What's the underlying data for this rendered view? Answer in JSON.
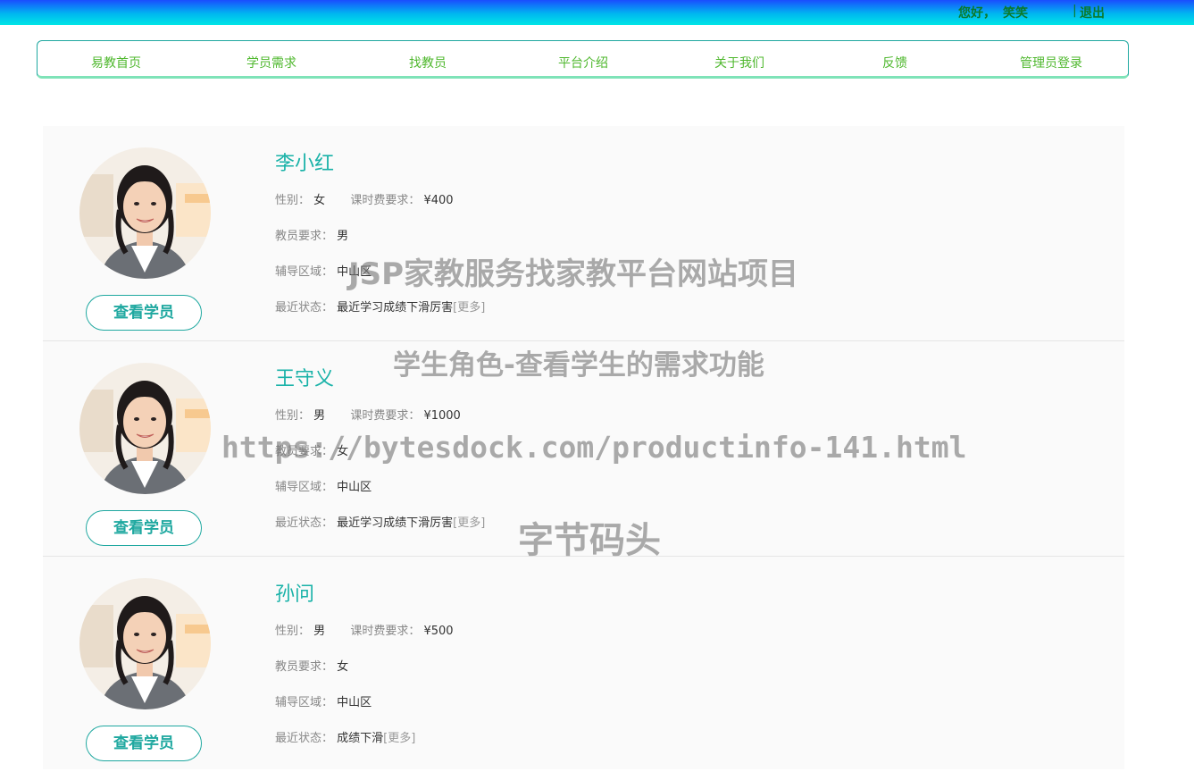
{
  "header": {
    "greeting": "您好，",
    "username": "笑笑",
    "separator": "|",
    "logout_label": "退出"
  },
  "nav": {
    "items": [
      {
        "label": "易教首页"
      },
      {
        "label": "学员需求"
      },
      {
        "label": "找教员"
      },
      {
        "label": "平台介绍"
      },
      {
        "label": "关于我们"
      },
      {
        "label": "反馈"
      },
      {
        "label": "管理员登录"
      }
    ]
  },
  "labels": {
    "gender": "性别：",
    "fee": "课时费要求：",
    "tutor_req": "教员要求：",
    "area": "辅导区域：",
    "status": "最近状态：",
    "more": "[更多]",
    "view_button": "查看学员"
  },
  "students": [
    {
      "name": "李小红",
      "gender": "女",
      "fee": "¥400",
      "tutor_req": "男",
      "area": "中山区",
      "status": "最近学习成绩下滑厉害"
    },
    {
      "name": "王守义",
      "gender": "男",
      "fee": "¥1000",
      "tutor_req": "女",
      "area": "中山区",
      "status": "最近学习成绩下滑厉害"
    },
    {
      "name": "孙问",
      "gender": "男",
      "fee": "¥500",
      "tutor_req": "女",
      "area": "中山区",
      "status": "成绩下滑"
    }
  ],
  "watermark": {
    "line1": "JSP家教服务找家教平台网站项目",
    "line2": "学生角色-查看学生的需求功能",
    "line3": "https://bytesdock.com/productinfo-141.html",
    "line4": "字节码头"
  },
  "colors": {
    "accent": "#19b2a8",
    "nav_text": "#4fb82e",
    "header_text": "#0b7a2a"
  }
}
